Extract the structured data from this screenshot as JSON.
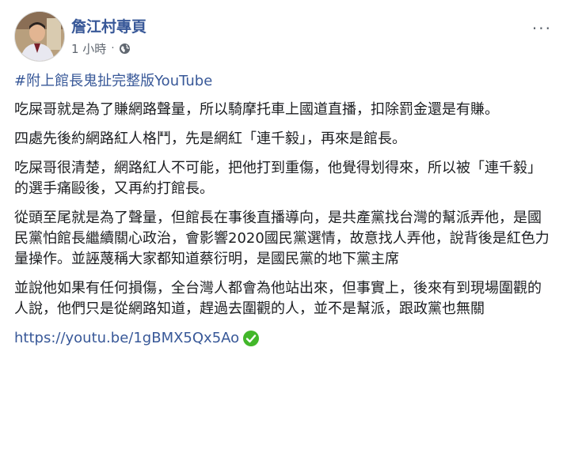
{
  "post": {
    "author": "詹江村專頁",
    "time": "1 小時",
    "separator": "·",
    "more": "···",
    "hashtag": "#附上館長鬼扯完整版YouTube",
    "paragraphs": [
      "吃屎哥就是為了賺網路聲量，所以騎摩托車上國道直播，扣除罰金還是有賺。",
      "四處先後約網路紅人格鬥，先是網紅「連千毅」，再來是館長。",
      "吃屎哥很清楚，網路紅人不可能，把他打到重傷，他覺得划得來，所以被「連千毅」的選手痛毆後，又再約打館長。",
      "從頭至尾就是為了聲量，但館長在事後直播導向，是共產黨找台灣的幫派弄他，是國民黨怕館長繼續關心政治，會影響2020國民黨選情，故意找人弄他，說背後是紅色力量操作。並誣蔑稱大家都知道蔡衍明，是國民黨的地下黨主席",
      "並說他如果有任何損傷，全台灣人都會為他站出來，但事實上，後來有到現場圍觀的人說，他們只是從網路知道，趕過去圍觀的人，並不是幫派，跟政黨也無關"
    ],
    "link": "https://youtu.be/1gBMX5Qx5Ao"
  },
  "colors": {
    "link": "#385898",
    "text": "#1c1e21",
    "meta": "#606770",
    "verified": "#42b72a"
  }
}
